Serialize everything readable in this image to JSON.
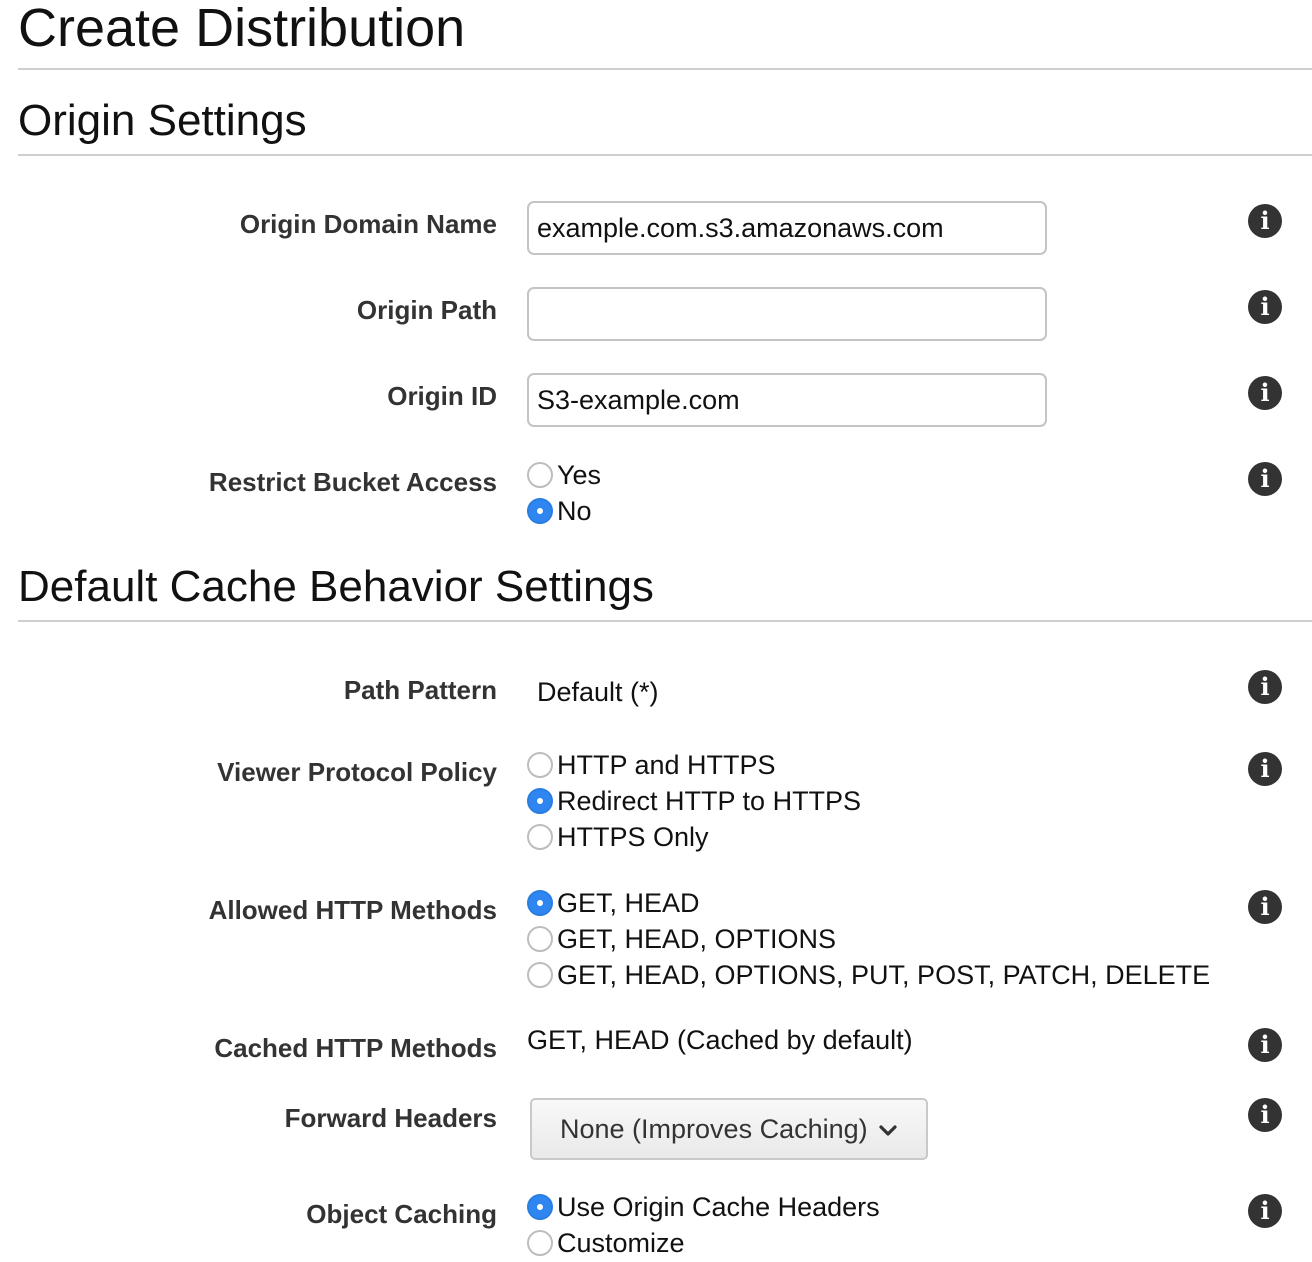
{
  "page": {
    "title": "Create Distribution"
  },
  "origin_settings": {
    "title": "Origin Settings",
    "origin_domain_name": {
      "label": "Origin Domain Name",
      "value": "example.com.s3.amazonaws.com"
    },
    "origin_path": {
      "label": "Origin Path",
      "value": ""
    },
    "origin_id": {
      "label": "Origin ID",
      "value": "S3-example.com"
    },
    "restrict_bucket_access": {
      "label": "Restrict Bucket Access",
      "options": [
        "Yes",
        "No"
      ],
      "selected": "No"
    }
  },
  "cache_behavior": {
    "title": "Default Cache Behavior Settings",
    "path_pattern": {
      "label": "Path Pattern",
      "value": "Default (*)"
    },
    "viewer_protocol_policy": {
      "label": "Viewer Protocol Policy",
      "options": [
        "HTTP and HTTPS",
        "Redirect HTTP to HTTPS",
        "HTTPS Only"
      ],
      "selected": "Redirect HTTP to HTTPS"
    },
    "allowed_http_methods": {
      "label": "Allowed HTTP Methods",
      "options": [
        "GET, HEAD",
        "GET, HEAD, OPTIONS",
        "GET, HEAD, OPTIONS, PUT, POST, PATCH, DELETE"
      ],
      "selected": "GET, HEAD"
    },
    "cached_http_methods": {
      "label": "Cached HTTP Methods",
      "value": "GET, HEAD (Cached by default)"
    },
    "forward_headers": {
      "label": "Forward Headers",
      "selected": "None (Improves Caching)"
    },
    "object_caching": {
      "label": "Object Caching",
      "options": [
        "Use Origin Cache Headers",
        "Customize"
      ],
      "selected": "Use Origin Cache Headers"
    }
  },
  "icons": {
    "info": "info-icon",
    "select_arrow": "chevron-down-icon"
  },
  "colors": {
    "radio_selected": "#2f86f0",
    "info_icon": "#333333",
    "divider": "#cfcfcf"
  }
}
